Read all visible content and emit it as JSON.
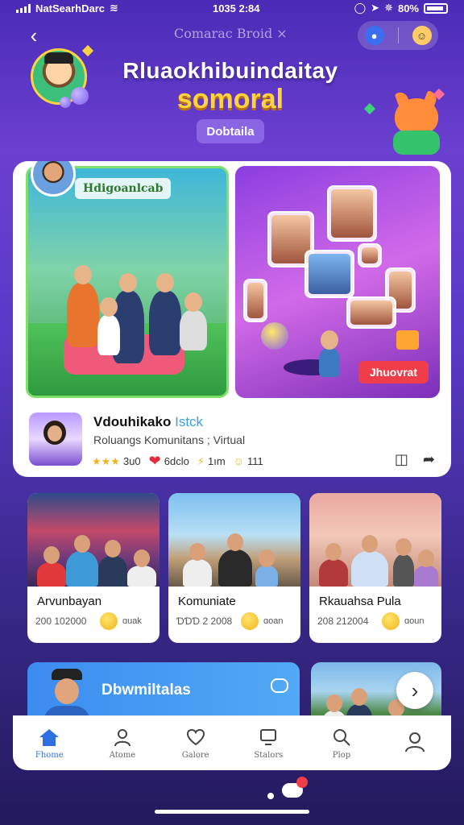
{
  "status_bar": {
    "carrier": "NatSearhDarc",
    "time": "1035 2:84",
    "battery": "80%"
  },
  "header": {
    "nav_title": "Comarac Broid ×",
    "hero_title": "Rluaokhibuindaitay",
    "hero_subtitle": "somoral",
    "details_label": "Dobtaila"
  },
  "featured": {
    "left_tag": "Hdigoanlcab",
    "join_label": "Jhuovrat",
    "name": "Vdouhikako",
    "name_suffix": "Istck",
    "description": "Roluangs Komunitans ; Virtual",
    "stats": {
      "rating": "3u0",
      "likes": "6dclo",
      "shares": "1ım",
      "reactions": "111"
    }
  },
  "grid_cards": [
    {
      "title": "Arvunbayan",
      "meta": "200 102000",
      "emoji_count": "ɑuak"
    },
    {
      "title": "Komuniate",
      "meta": "ƊƊƊ 2 2008",
      "emoji_count": "ɑoan"
    },
    {
      "title": "Rkauahsa Pula",
      "meta": "208 212004",
      "emoji_count": "ɑoun"
    }
  ],
  "banner": {
    "text": "Dbwmiltalas"
  },
  "tabbar": [
    {
      "label": "Fhome",
      "icon": "home-icon",
      "active": true
    },
    {
      "label": "Atome",
      "icon": "profile-icon",
      "active": false
    },
    {
      "label": "Galore",
      "icon": "heart-icon",
      "active": false
    },
    {
      "label": "Stalors",
      "icon": "monitor-icon",
      "active": false
    },
    {
      "label": "Plop",
      "icon": "search-icon",
      "active": false
    },
    {
      "label": "",
      "icon": "user-icon",
      "active": false
    }
  ],
  "colors": {
    "accent_blue": "#2f6fe0",
    "brand_purple": "#6b3fd0",
    "hero_yellow": "#ffd23f",
    "join_red": "#ef3e4a"
  }
}
